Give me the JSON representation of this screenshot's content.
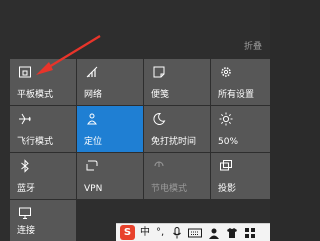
{
  "header": {
    "collapse_label": "折叠"
  },
  "tiles": [
    {
      "label": "平板模式",
      "icon": "tablet-mode-icon",
      "active": false,
      "dim": false
    },
    {
      "label": "网络",
      "icon": "network-icon",
      "active": false,
      "dim": false
    },
    {
      "label": "便笺",
      "icon": "note-icon",
      "active": false,
      "dim": false
    },
    {
      "label": "所有设置",
      "icon": "gear-icon",
      "active": false,
      "dim": false
    },
    {
      "label": "飞行模式",
      "icon": "airplane-icon",
      "active": false,
      "dim": false
    },
    {
      "label": "定位",
      "icon": "location-icon",
      "active": true,
      "dim": false
    },
    {
      "label": "免打扰时间",
      "icon": "moon-icon",
      "active": false,
      "dim": false
    },
    {
      "label": "50%",
      "icon": "brightness-icon",
      "active": false,
      "dim": false
    },
    {
      "label": "蓝牙",
      "icon": "bluetooth-icon",
      "active": false,
      "dim": false
    },
    {
      "label": "VPN",
      "icon": "vpn-icon",
      "active": false,
      "dim": false
    },
    {
      "label": "节电模式",
      "icon": "battery-saver-icon",
      "active": false,
      "dim": true
    },
    {
      "label": "投影",
      "icon": "project-icon",
      "active": false,
      "dim": false
    },
    {
      "label": "连接",
      "icon": "connect-icon",
      "active": false,
      "dim": false
    }
  ],
  "taskbar": {
    "ime_logo": "S",
    "ime_mode": "中",
    "items": [
      "ime-punctuation-icon",
      "microphone-icon",
      "keyboard-icon",
      "user-icon",
      "shirt-icon",
      "grid-icon"
    ]
  },
  "colors": {
    "tile_bg": "#575757",
    "tile_active": "#1f7fd3",
    "panel_bg": "#2e2e2e",
    "arrow": "#e8342a"
  }
}
